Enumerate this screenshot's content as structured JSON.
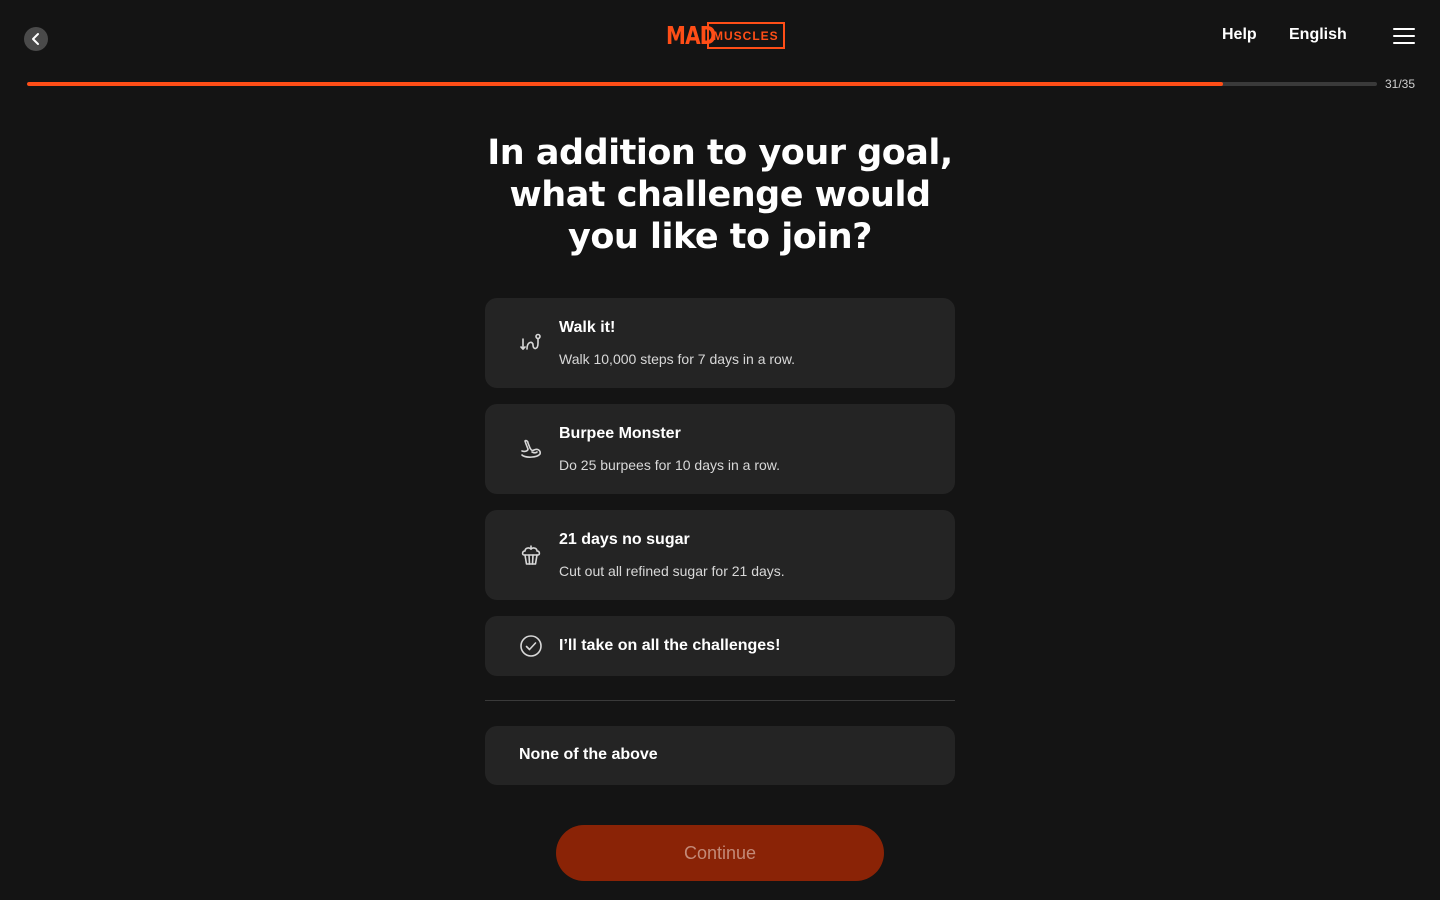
{
  "header": {
    "logo_left": "MAD",
    "logo_right": "MUSCLES",
    "help_label": "Help",
    "language_label": "English"
  },
  "progress": {
    "text": "31/35",
    "fraction": 0.886
  },
  "question": {
    "title": "In addition to your goal, what challenge would you like to join?"
  },
  "options": [
    {
      "title": "Walk it!",
      "description": "Walk 10,000 steps for 7 days in a row.",
      "icon": "walk-route-icon"
    },
    {
      "title": "Burpee Monster",
      "description": "Do 25 burpees for 10 days in a row.",
      "icon": "flexed-arm-icon"
    },
    {
      "title": "21 days no sugar",
      "description": "Cut out all refined sugar for 21 days.",
      "icon": "cupcake-icon"
    },
    {
      "title": "I’ll take on all the challenges!",
      "icon": "check-circle-icon"
    }
  ],
  "none_option": {
    "label": "None of the above"
  },
  "continue_label": "Continue",
  "colors": {
    "background": "#141414",
    "card": "#242424",
    "accent": "#ff4e17",
    "button_disabled": "#8a2306",
    "progress_track": "#3a3a3a"
  }
}
